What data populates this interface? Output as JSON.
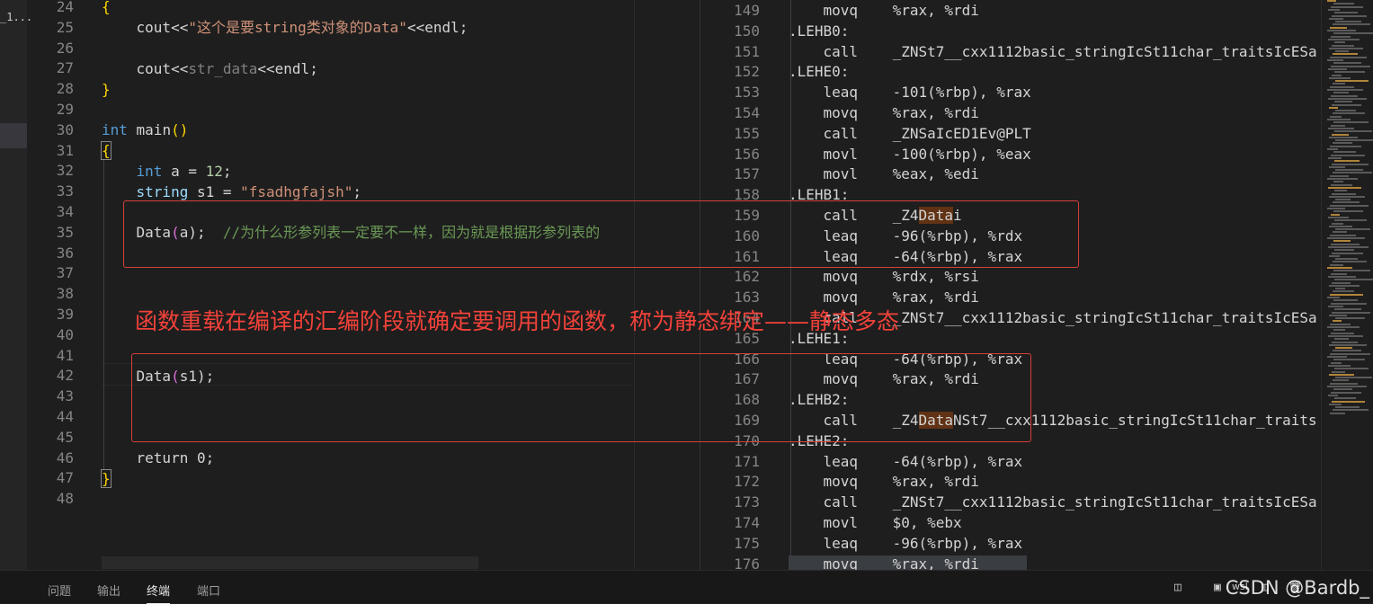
{
  "sidebar": {
    "label": "_1..."
  },
  "left_editor": {
    "line_numbers": [
      "24",
      "25",
      "26",
      "27",
      "28",
      "29",
      "30",
      "31",
      "32",
      "33",
      "34",
      "35",
      "36",
      "37",
      "38",
      "39",
      "40",
      "41",
      "42",
      "43",
      "44",
      "45",
      "46",
      "47",
      "48"
    ],
    "code": {
      "l24": "{",
      "l25_a": "cout<<",
      "l25_b": "\"这个是要string类对象的Data\"",
      "l25_c": "<<endl;",
      "l27_a": "cout<<",
      "l27_b": "str_data",
      "l27_c": "<<endl;",
      "l28": "}",
      "l30_a": "int",
      "l30_b": " main",
      "l30_c": "()",
      "l31": "{",
      "l32_a": "int",
      "l32_b": " a = ",
      "l32_c": "12",
      "l32_d": ";",
      "l33_a": "string",
      "l33_b": " s1 = ",
      "l33_c": "\"fsadhgfajsh\"",
      "l33_d": ";",
      "l35_a": "Data",
      "l35_b": "(",
      "l35_c": "a",
      "l35_d": ");",
      "l35_e": "  //为什么形参列表一定要不一样，因为就是根据形参列表的",
      "l42_a": "Data",
      "l42_b": "(",
      "l42_c": "s1",
      "l42_d": ");",
      "l46_a": "return",
      "l46_b": " 0;",
      "l47": "}"
    }
  },
  "right_editor": {
    "line_numbers": [
      "149",
      "150",
      "151",
      "152",
      "153",
      "154",
      "155",
      "156",
      "157",
      "158",
      "159",
      "160",
      "161",
      "162",
      "163",
      "164",
      "165",
      "166",
      "167",
      "168",
      "169",
      "170",
      "171",
      "172",
      "173",
      "174",
      "175",
      "176"
    ],
    "lines": [
      {
        "label": "",
        "op": "movq",
        "args": "%rax, %rdi"
      },
      {
        "label": ".LEHB0:",
        "op": "",
        "args": ""
      },
      {
        "label": "",
        "op": "call",
        "args": "_ZNSt7__cxx1112basic_stringIcSt11char_traitsIcESa"
      },
      {
        "label": ".LEHE0:",
        "op": "",
        "args": ""
      },
      {
        "label": "",
        "op": "leaq",
        "args": "-101(%rbp), %rax"
      },
      {
        "label": "",
        "op": "movq",
        "args": "%rax, %rdi"
      },
      {
        "label": "",
        "op": "call",
        "args": "_ZNSaIcED1Ev@PLT"
      },
      {
        "label": "",
        "op": "movl",
        "args": "-100(%rbp), %eax"
      },
      {
        "label": "",
        "op": "movl",
        "args": "%eax, %edi"
      },
      {
        "label": ".LEHB1:",
        "op": "",
        "args": ""
      },
      {
        "label": "",
        "op": "call",
        "args_pre": "_Z4",
        "args_hl": "Data",
        "args_post": "i"
      },
      {
        "label": "",
        "op": "leaq",
        "args": "-96(%rbp), %rdx"
      },
      {
        "label": "",
        "op": "leaq",
        "args": "-64(%rbp), %rax"
      },
      {
        "label": "",
        "op": "movq",
        "args": "%rdx, %rsi"
      },
      {
        "label": "",
        "op": "movq",
        "args": "%rax, %rdi"
      },
      {
        "label": "",
        "op": "call",
        "args": "_ZNSt7__cxx1112basic_stringIcSt11char_traitsIcESa"
      },
      {
        "label": ".LEHE1:",
        "op": "",
        "args": ""
      },
      {
        "label": "",
        "op": "leaq",
        "args": "-64(%rbp), %rax"
      },
      {
        "label": "",
        "op": "movq",
        "args": "%rax, %rdi"
      },
      {
        "label": ".LEHB2:",
        "op": "",
        "args": ""
      },
      {
        "label": "",
        "op": "call",
        "args_pre": "_Z4",
        "args_hl": "Data",
        "args_post": "NSt7__cxx1112basic_stringIcSt11char_traits"
      },
      {
        "label": ".LEHE2:",
        "op": "",
        "args": ""
      },
      {
        "label": "",
        "op": "leaq",
        "args": "-64(%rbp), %rax"
      },
      {
        "label": "",
        "op": "movq",
        "args": "%rax, %rdi"
      },
      {
        "label": "",
        "op": "call",
        "args": "_ZNSt7__cxx1112basic_stringIcSt11char_traitsIcESa"
      },
      {
        "label": "",
        "op": "movl",
        "args": "$0, %ebx"
      },
      {
        "label": "",
        "op": "leaq",
        "args": "-96(%rbp), %rax"
      },
      {
        "label": "",
        "op": "movq",
        "args": "%rax, %rdi"
      }
    ]
  },
  "annotation": "函数重载在编译的汇编阶段就确定要调用的函数，称为静态绑定——静态多态",
  "panel": {
    "tabs": [
      "问题",
      "输出",
      "终端",
      "端口"
    ],
    "active_tab": "终端",
    "terminal_name": "wsl"
  },
  "watermark": "CSDN @Bardb_",
  "colors": {
    "background": "#1e1e1e",
    "annotation_red": "#f2423a",
    "highlight": "#613214"
  }
}
